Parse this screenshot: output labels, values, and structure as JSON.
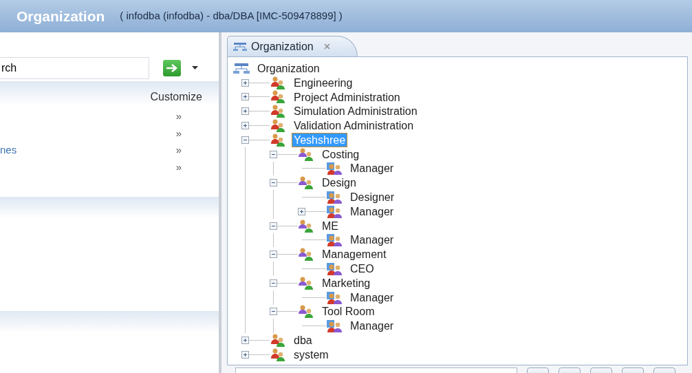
{
  "window": {
    "title": "Organization",
    "subtitle": "( infodba (infodba) - dba/DBA [IMC-509478899] )"
  },
  "left_panel": {
    "search": {
      "value": "rch"
    },
    "header": {
      "action": "Customize"
    },
    "rows": [
      {
        "more": "»"
      },
      {
        "more": "»"
      },
      {
        "label": "nes",
        "more": "»"
      },
      {
        "more": "»"
      }
    ]
  },
  "tab": {
    "label": "Organization",
    "selected": true
  },
  "tree": {
    "label": "Organization",
    "kind": "root",
    "selected": false,
    "children": [
      {
        "label": "Engineering",
        "kind": "group",
        "expanded": false,
        "selected": false
      },
      {
        "label": "Project Administration",
        "kind": "group",
        "expanded": false,
        "selected": false
      },
      {
        "label": "Simulation Administration",
        "kind": "group",
        "expanded": false,
        "selected": false
      },
      {
        "label": "Validation Administration",
        "kind": "group",
        "expanded": false,
        "selected": false
      },
      {
        "label": "Yeshshree",
        "kind": "group",
        "expanded": true,
        "selected": true,
        "children": [
          {
            "label": "Costing",
            "kind": "subgroup",
            "expanded": true,
            "selected": false,
            "children": [
              {
                "label": "Manager",
                "kind": "role",
                "selected": false
              }
            ]
          },
          {
            "label": "Design",
            "kind": "subgroup",
            "expanded": true,
            "selected": false,
            "children": [
              {
                "label": "Designer",
                "kind": "role",
                "selected": false
              },
              {
                "label": "Manager",
                "kind": "role",
                "expanded": false,
                "selected": false
              }
            ]
          },
          {
            "label": "ME",
            "kind": "subgroup",
            "expanded": true,
            "selected": false,
            "children": [
              {
                "label": "Manager",
                "kind": "role",
                "selected": false
              }
            ]
          },
          {
            "label": "Management",
            "kind": "subgroup",
            "expanded": true,
            "selected": false,
            "children": [
              {
                "label": "CEO",
                "kind": "role",
                "selected": false
              }
            ]
          },
          {
            "label": "Marketing",
            "kind": "subgroup",
            "expanded": true,
            "selected": false,
            "children": [
              {
                "label": "Manager",
                "kind": "role",
                "selected": false
              }
            ]
          },
          {
            "label": "Tool Room",
            "kind": "subgroup",
            "expanded": true,
            "selected": false,
            "children": [
              {
                "label": "Manager",
                "kind": "role",
                "selected": false
              }
            ]
          }
        ]
      },
      {
        "label": "dba",
        "kind": "group",
        "expanded": false,
        "selected": false
      },
      {
        "label": "system",
        "kind": "group",
        "expanded": false,
        "selected": false
      }
    ]
  }
}
